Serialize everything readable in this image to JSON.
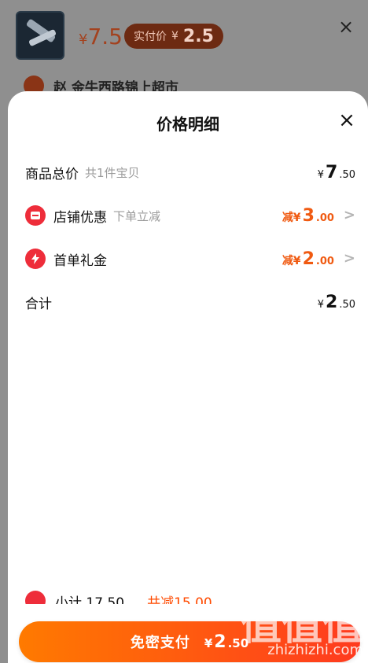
{
  "background": {
    "price_main": "7.5",
    "currency": "¥",
    "badge_label": "实付价",
    "badge_currency": "¥",
    "badge_value": "2.5",
    "shop_name": "赵 金牛西路锦上超市",
    "close_icon": "close-icon"
  },
  "sheet": {
    "title": "价格明细",
    "close_icon": "close-icon",
    "rows": {
      "total": {
        "label": "商品总价",
        "sub": "共1件宝贝",
        "currency": "¥",
        "int": "7",
        "dec": ".50"
      },
      "store_discount": {
        "label": "店铺优惠",
        "sub": "下单立减",
        "prefix": "减¥",
        "int": "3",
        "dec": ".00",
        "icon": "store-icon"
      },
      "first_order": {
        "label": "首单礼金",
        "prefix": "减¥",
        "int": "2",
        "dec": ".00",
        "icon": "lightning-icon"
      },
      "sum": {
        "label": "合计",
        "currency": "¥",
        "int": "2",
        "dec": ".50"
      }
    }
  },
  "bottom": {
    "peek_text": "小计 17.50，",
    "peek_highlight": "共减15.00",
    "pay_button": {
      "label": "免密支付",
      "currency": "¥",
      "int": "2",
      "dec": ".50"
    }
  },
  "watermark": {
    "main": "值值值",
    "url": "zhizhizhi.com"
  },
  "colors": {
    "accent_orange": "#f05a11",
    "accent_red": "#ee2d3a",
    "pay_gradient_start": "#ff7a00",
    "pay_gradient_end": "#ff3a1f"
  }
}
